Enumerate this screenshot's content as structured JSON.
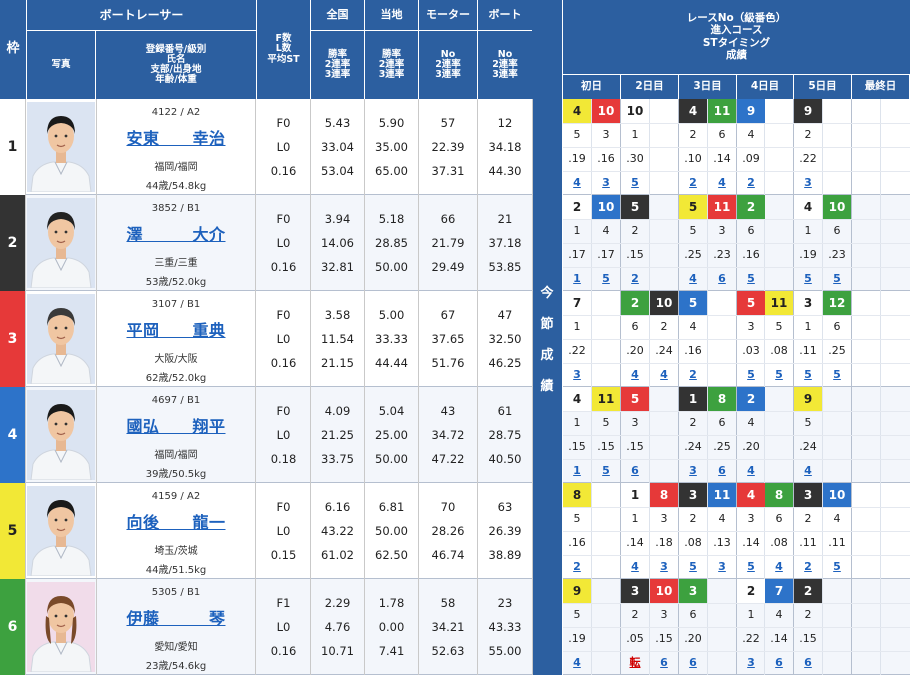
{
  "headers": {
    "waku": "枠",
    "racer_section": "ボートレーサー",
    "photo": "写真",
    "info_lines": [
      "登録番号/級別",
      "氏名",
      "支部/出身地",
      "年齢/体重"
    ],
    "fl_lines": [
      "F数",
      "L数",
      "平均ST"
    ],
    "zenkoku": "全国",
    "touchi": "当地",
    "motor": "モーター",
    "boat": "ボート",
    "win_lines": [
      "勝率",
      "2連率",
      "3連率"
    ],
    "mb_lines": [
      "No",
      "2連率",
      "3連率"
    ],
    "race_lines": [
      "レースNo（級番色）",
      "進入コース",
      "STタイミング",
      "成績"
    ],
    "days": [
      "初日",
      "2日目",
      "3日目",
      "4日目",
      "5日目",
      "最終日"
    ],
    "konsetsu": [
      "今",
      "節",
      "成",
      "績"
    ]
  },
  "colors": {
    "header_bg": "#2c5fa0",
    "waku1": "#ffffff",
    "waku2": "#333333",
    "waku3": "#e63939",
    "waku4": "#2d73c9",
    "waku5": "#f2e836",
    "waku6": "#3da13f",
    "row_stripe": "#f3f6fb"
  },
  "racers": [
    {
      "waku": "1",
      "reg_class": "4122 / A2",
      "name": "安東　　幸治",
      "branch": "福岡/福岡",
      "age_weight": "44歳/54.8kg",
      "f": "F0",
      "l": "L0",
      "st": "0.16",
      "national": [
        "5.43",
        "33.04",
        "53.04"
      ],
      "local": [
        "5.90",
        "35.00",
        "65.00"
      ],
      "motor": [
        "57",
        "22.39",
        "37.31"
      ],
      "boat": [
        "12",
        "34.18",
        "44.30"
      ],
      "hair": "#1a1a1a",
      "photo_bg": "#dbe4f2",
      "races": [
        {
          "slot": 0,
          "color": "y",
          "r": "4",
          "c": "5",
          "st": ".19",
          "res": "4"
        },
        {
          "slot": 1,
          "color": "r",
          "r": "10",
          "c": "3",
          "st": ".16",
          "res": "3"
        },
        {
          "slot": 2,
          "color": "w",
          "r": "10",
          "c": "1",
          "st": ".30",
          "res": "5"
        },
        {
          "slot": 4,
          "color": "k",
          "r": "4",
          "c": "2",
          "st": ".10",
          "res": "2"
        },
        {
          "slot": 5,
          "color": "g",
          "r": "11",
          "c": "6",
          "st": ".14",
          "res": "4"
        },
        {
          "slot": 6,
          "color": "b",
          "r": "9",
          "c": "4",
          "st": ".09",
          "res": "2"
        },
        {
          "slot": 8,
          "color": "k",
          "r": "9",
          "c": "2",
          "st": ".22",
          "res": "3"
        }
      ]
    },
    {
      "waku": "2",
      "reg_class": "3852 / B1",
      "name": "澤　　　大介",
      "branch": "三重/三重",
      "age_weight": "53歳/52.0kg",
      "f": "F0",
      "l": "L0",
      "st": "0.16",
      "national": [
        "3.94",
        "14.06",
        "32.81"
      ],
      "local": [
        "5.18",
        "28.85",
        "50.00"
      ],
      "motor": [
        "66",
        "21.79",
        "29.49"
      ],
      "boat": [
        "21",
        "37.18",
        "53.85"
      ],
      "hair": "#222222",
      "photo_bg": "#dbe4f2",
      "races": [
        {
          "slot": 0,
          "color": "w",
          "r": "2",
          "c": "1",
          "st": ".17",
          "res": "1"
        },
        {
          "slot": 1,
          "color": "b",
          "r": "10",
          "c": "4",
          "st": ".17",
          "res": "5"
        },
        {
          "slot": 2,
          "color": "k",
          "r": "5",
          "c": "2",
          "st": ".15",
          "res": "2"
        },
        {
          "slot": 4,
          "color": "y",
          "r": "5",
          "c": "5",
          "st": ".25",
          "res": "4"
        },
        {
          "slot": 5,
          "color": "r",
          "r": "11",
          "c": "3",
          "st": ".23",
          "res": "6"
        },
        {
          "slot": 6,
          "color": "g",
          "r": "2",
          "c": "6",
          "st": ".16",
          "res": "5"
        },
        {
          "slot": 8,
          "color": "w",
          "r": "4",
          "c": "1",
          "st": ".19",
          "res": "5"
        },
        {
          "slot": 9,
          "color": "g",
          "r": "10",
          "c": "6",
          "st": ".23",
          "res": "5"
        }
      ]
    },
    {
      "waku": "3",
      "reg_class": "3107 / B1",
      "name": "平岡　　重典",
      "branch": "大阪/大阪",
      "age_weight": "62歳/52.0kg",
      "f": "F0",
      "l": "L0",
      "st": "0.16",
      "national": [
        "3.58",
        "11.54",
        "21.15"
      ],
      "local": [
        "5.00",
        "33.33",
        "44.44"
      ],
      "motor": [
        "67",
        "37.65",
        "51.76"
      ],
      "boat": [
        "47",
        "32.50",
        "46.25"
      ],
      "hair": "#3a3a3a",
      "photo_bg": "#dbe4f2",
      "races": [
        {
          "slot": 0,
          "color": "w",
          "r": "7",
          "c": "1",
          "st": ".22",
          "res": "3"
        },
        {
          "slot": 2,
          "color": "g",
          "r": "2",
          "c": "6",
          "st": ".20",
          "res": "4"
        },
        {
          "slot": 3,
          "color": "k",
          "r": "10",
          "c": "2",
          "st": ".24",
          "res": "4"
        },
        {
          "slot": 4,
          "color": "b",
          "r": "5",
          "c": "4",
          "st": ".16",
          "res": "2"
        },
        {
          "slot": 6,
          "color": "r",
          "r": "5",
          "c": "3",
          "st": ".03",
          "res": "5"
        },
        {
          "slot": 7,
          "color": "y",
          "r": "11",
          "c": "5",
          "st": ".08",
          "res": "5"
        },
        {
          "slot": 8,
          "color": "w",
          "r": "3",
          "c": "1",
          "st": ".11",
          "res": "5"
        },
        {
          "slot": 9,
          "color": "g",
          "r": "12",
          "c": "6",
          "st": ".25",
          "res": "5"
        }
      ]
    },
    {
      "waku": "4",
      "reg_class": "4697 / B1",
      "name": "國弘　　翔平",
      "branch": "福岡/福岡",
      "age_weight": "39歳/50.5kg",
      "f": "F0",
      "l": "L0",
      "st": "0.18",
      "national": [
        "4.09",
        "21.25",
        "33.75"
      ],
      "local": [
        "5.04",
        "25.00",
        "50.00"
      ],
      "motor": [
        "43",
        "34.72",
        "47.22"
      ],
      "boat": [
        "61",
        "28.75",
        "40.50"
      ],
      "hair": "#1a1a1a",
      "photo_bg": "#dbe4f2",
      "races": [
        {
          "slot": 0,
          "color": "w",
          "r": "4",
          "c": "1",
          "st": ".15",
          "res": "1"
        },
        {
          "slot": 1,
          "color": "y",
          "r": "11",
          "c": "5",
          "st": ".15",
          "res": "5"
        },
        {
          "slot": 2,
          "color": "r",
          "r": "5",
          "c": "3",
          "st": ".15",
          "res": "6"
        },
        {
          "slot": 4,
          "color": "k",
          "r": "1",
          "c": "2",
          "st": ".24",
          "res": "3"
        },
        {
          "slot": 5,
          "color": "g",
          "r": "8",
          "c": "6",
          "st": ".25",
          "res": "6"
        },
        {
          "slot": 6,
          "color": "b",
          "r": "2",
          "c": "4",
          "st": ".20",
          "res": "4"
        },
        {
          "slot": 8,
          "color": "y",
          "r": "9",
          "c": "5",
          "st": ".24",
          "res": "4"
        }
      ]
    },
    {
      "waku": "5",
      "reg_class": "4159 / A2",
      "name": "向後　　龍一",
      "branch": "埼玉/茨城",
      "age_weight": "44歳/51.5kg",
      "f": "F0",
      "l": "L0",
      "st": "0.15",
      "national": [
        "6.16",
        "43.22",
        "61.02"
      ],
      "local": [
        "6.81",
        "50.00",
        "62.50"
      ],
      "motor": [
        "70",
        "28.26",
        "46.74"
      ],
      "boat": [
        "63",
        "26.39",
        "38.89"
      ],
      "hair": "#1a1a1a",
      "photo_bg": "#dbe4f2",
      "races": [
        {
          "slot": 0,
          "color": "y",
          "r": "8",
          "c": "5",
          "st": ".16",
          "res": "2"
        },
        {
          "slot": 2,
          "color": "w",
          "r": "1",
          "c": "1",
          "st": ".14",
          "res": "4"
        },
        {
          "slot": 3,
          "color": "r",
          "r": "8",
          "c": "3",
          "st": ".18",
          "res": "3"
        },
        {
          "slot": 4,
          "color": "k",
          "r": "3",
          "c": "2",
          "st": ".08",
          "res": "5"
        },
        {
          "slot": 5,
          "color": "b",
          "r": "11",
          "c": "4",
          "st": ".13",
          "res": "3"
        },
        {
          "slot": 6,
          "color": "r",
          "r": "4",
          "c": "3",
          "st": ".14",
          "res": "5"
        },
        {
          "slot": 7,
          "color": "g",
          "r": "8",
          "c": "6",
          "st": ".08",
          "res": "4"
        },
        {
          "slot": 8,
          "color": "k",
          "r": "3",
          "c": "2",
          "st": ".11",
          "res": "2"
        },
        {
          "slot": 9,
          "color": "b",
          "r": "10",
          "c": "4",
          "st": ".11",
          "res": "5"
        }
      ]
    },
    {
      "waku": "6",
      "reg_class": "5305 / B1",
      "name": "伊藤　　　琴",
      "branch": "愛知/愛知",
      "age_weight": "23歳/54.6kg",
      "f": "F1",
      "l": "L0",
      "st": "0.16",
      "national": [
        "2.29",
        "4.76",
        "10.71"
      ],
      "local": [
        "1.78",
        "0.00",
        "7.41"
      ],
      "motor": [
        "58",
        "34.21",
        "52.63"
      ],
      "boat": [
        "23",
        "43.33",
        "55.00"
      ],
      "hair": "#7a4a2a",
      "photo_bg": "#f1dcea",
      "races": [
        {
          "slot": 0,
          "color": "y",
          "r": "9",
          "c": "5",
          "st": ".19",
          "res": "4"
        },
        {
          "slot": 2,
          "color": "k",
          "r": "3",
          "c": "2",
          "st": ".05",
          "res": "転"
        },
        {
          "slot": 3,
          "color": "r",
          "r": "10",
          "c": "3",
          "st": ".15",
          "res": "6"
        },
        {
          "slot": 4,
          "color": "g",
          "r": "3",
          "c": "6",
          "st": ".20",
          "res": "6"
        },
        {
          "slot": 6,
          "color": "w",
          "r": "2",
          "c": "1",
          "st": ".22",
          "res": "3"
        },
        {
          "slot": 7,
          "color": "b",
          "r": "7",
          "c": "4",
          "st": ".14",
          "res": "6"
        },
        {
          "slot": 8,
          "color": "k",
          "r": "2",
          "c": "2",
          "st": ".15",
          "res": "6"
        }
      ]
    }
  ]
}
